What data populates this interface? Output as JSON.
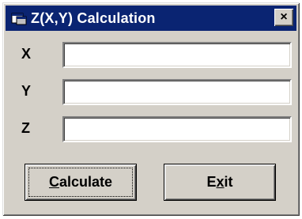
{
  "window": {
    "title": "Z(X,Y) Calculation",
    "icon": "app-window-icon",
    "close_glyph": "×"
  },
  "fields": [
    {
      "label": "X",
      "value": ""
    },
    {
      "label": "Y",
      "value": ""
    },
    {
      "label": "Z",
      "value": ""
    }
  ],
  "buttons": {
    "calculate": {
      "mnemonic": "C",
      "rest": "alculate"
    },
    "exit": {
      "pre": "E",
      "mnemonic": "x",
      "rest": "it"
    }
  },
  "colors": {
    "titlebar": "#0a2472",
    "face": "#d4d0c8"
  }
}
